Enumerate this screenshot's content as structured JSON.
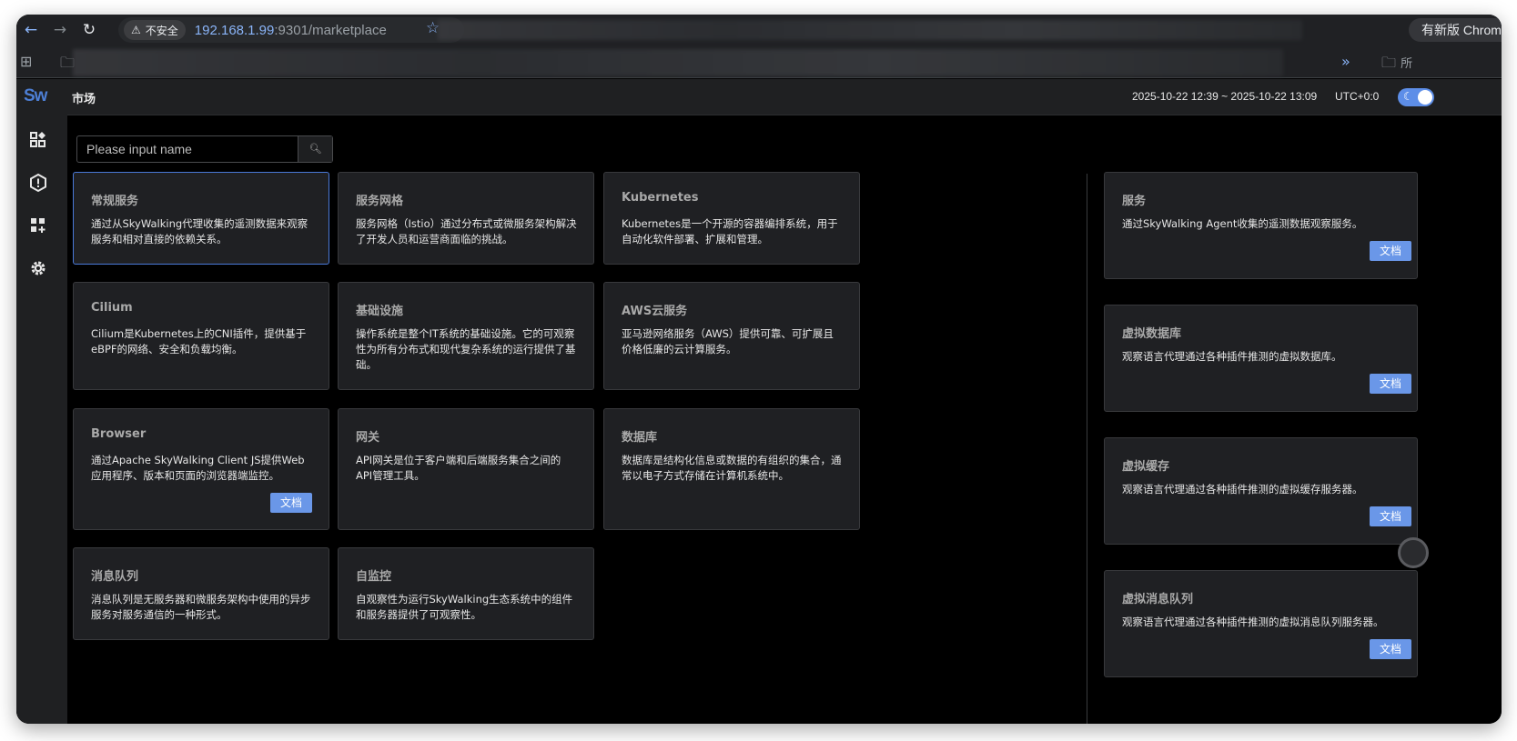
{
  "browser": {
    "secure_label": "不安全",
    "url_host": "192.168.1.99",
    "url_rest": ":9301/marketplace",
    "update_label": "有新版 Chrome 可",
    "bookmarks_folder_label": "所"
  },
  "app": {
    "logo": "Sw",
    "page_title": "市场",
    "time_range": "2025-10-22 12:39 ~ 2025-10-22 13:09",
    "timezone": "UTC+0:0",
    "theme_toggle": "dark",
    "search_placeholder": "Please input name"
  },
  "cards": [
    {
      "title": "常规服务",
      "desc": "通过从SkyWalking代理收集的遥测数据来观察服务和相对直接的依赖关系。"
    },
    {
      "title": "服务网格",
      "desc": "服务网格（Istio）通过分布式或微服务架构解决了开发人员和运营商面临的挑战。"
    },
    {
      "title": "Kubernetes",
      "desc": "Kubernetes是一个开源的容器编排系统，用于自动化软件部署、扩展和管理。"
    },
    {
      "title": "Cilium",
      "desc": "Cilium是Kubernetes上的CNI插件，提供基于eBPF的网络、安全和负载均衡。"
    },
    {
      "title": "基础设施",
      "desc": "操作系统是整个IT系统的基础设施。它的可观察性为所有分布式和现代复杂系统的运行提供了基础。"
    },
    {
      "title": "AWS云服务",
      "desc": "亚马逊网络服务（AWS）提供可靠、可扩展且价格低廉的云计算服务。"
    },
    {
      "title": "Browser",
      "desc": "通过Apache SkyWalking Client JS提供Web应用程序、版本和页面的浏览器端监控。",
      "button": "文档"
    },
    {
      "title": "网关",
      "desc": "API网关是位于客户端和后端服务集合之间的API管理工具。"
    },
    {
      "title": "数据库",
      "desc": "数据库是结构化信息或数据的有组织的集合，通常以电子方式存储在计算机系统中。"
    },
    {
      "title": "消息队列",
      "desc": "消息队列是无服务器和微服务架构中使用的异步服务对服务通信的一种形式。"
    },
    {
      "title": "自监控",
      "desc": "自观察性为运行SkyWalking生态系统中的组件和服务器提供了可观察性。"
    }
  ],
  "right_cards": [
    {
      "title": "服务",
      "desc": "通过SkyWalking Agent收集的遥测数据观察服务。",
      "button": "文档"
    },
    {
      "title": "虚拟数据库",
      "desc": "观察语言代理通过各种插件推测的虚拟数据库。",
      "button": "文档"
    },
    {
      "title": "虚拟缓存",
      "desc": "观察语言代理通过各种插件推测的虚拟缓存服务器。",
      "button": "文档"
    },
    {
      "title": "虚拟消息队列",
      "desc": "观察语言代理通过各种插件推测的虚拟消息队列服务器。",
      "button": "文档"
    }
  ]
}
